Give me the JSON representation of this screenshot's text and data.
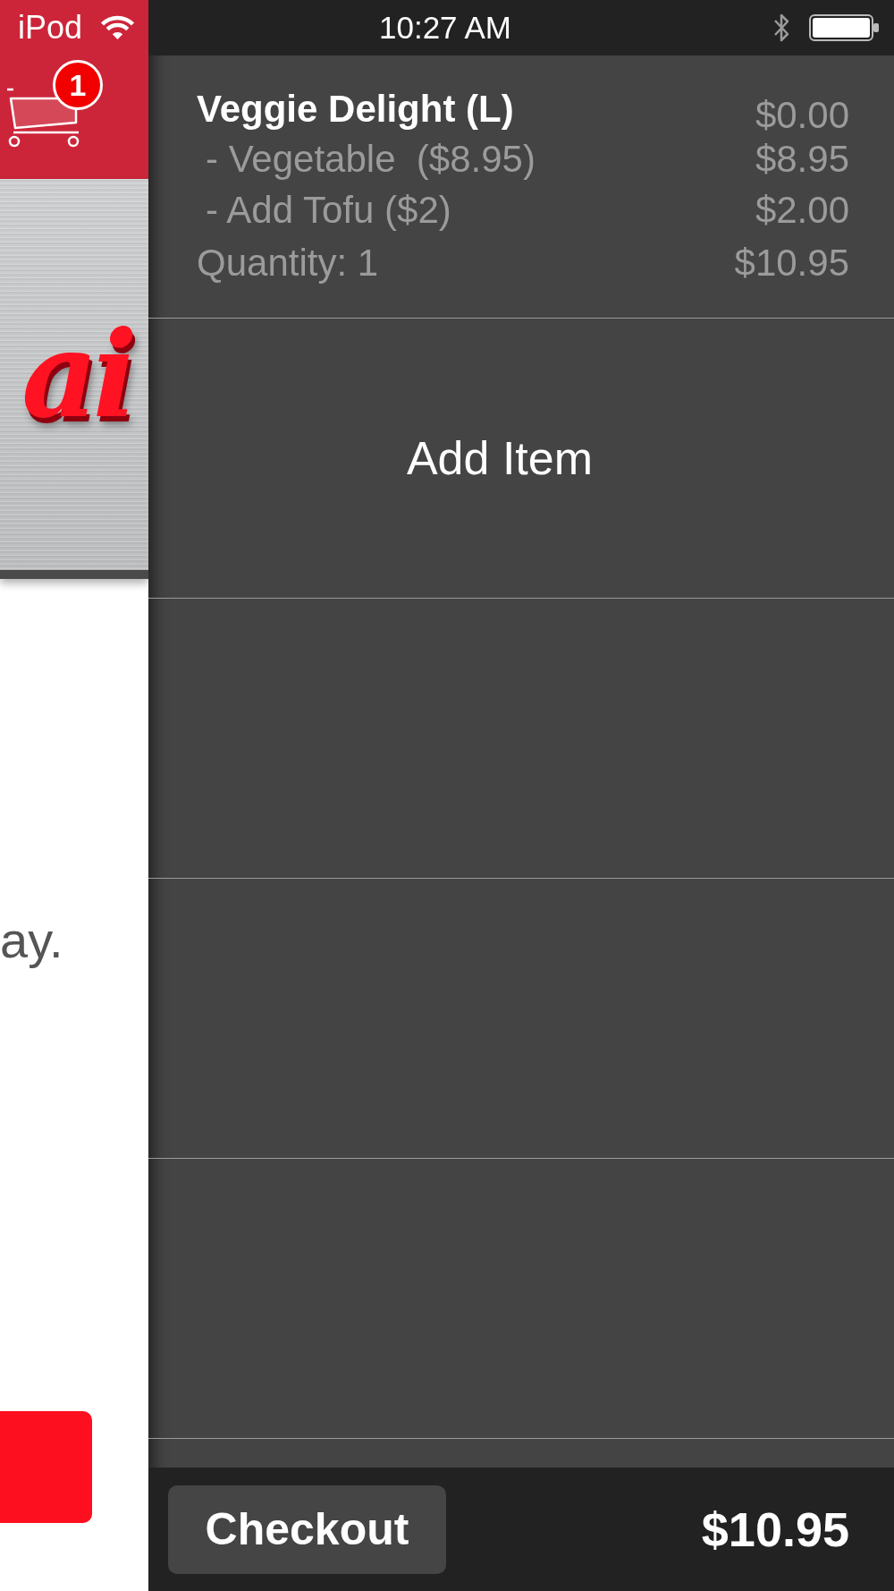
{
  "status_bar": {
    "carrier": "iPod",
    "time": "10:27 AM"
  },
  "header": {
    "cart_badge": "1"
  },
  "banner": {
    "logo_text": "ai"
  },
  "page": {
    "text_fragment": "ay."
  },
  "order": {
    "items": [
      {
        "name": "Veggie Delight (L)",
        "price": "$0.00",
        "options": [
          {
            "label": "- Vegetable  ($8.95)",
            "price": "$8.95"
          },
          {
            "label": "- Add Tofu ($2)",
            "price": "$2.00"
          }
        ],
        "quantity": "Quantity: 1",
        "total": "$10.95"
      }
    ],
    "add_item": "Add Item"
  },
  "footer": {
    "checkout": "Checkout",
    "total": "$10.95"
  }
}
